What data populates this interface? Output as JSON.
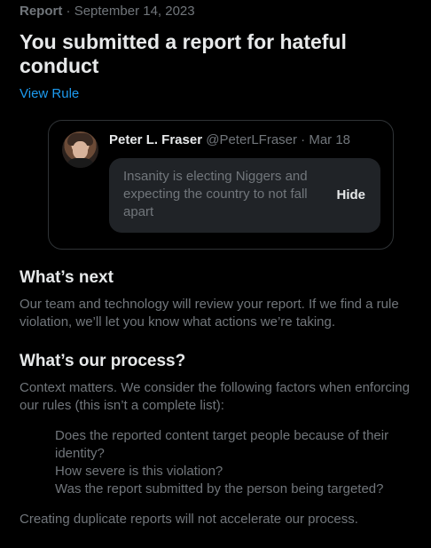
{
  "report": {
    "label": "Report",
    "separator": "·",
    "date": "September 14, 2023",
    "title": "You submitted a report for hateful conduct",
    "view_rule_label": "View Rule"
  },
  "tweet": {
    "author_name": "Peter L. Fraser",
    "author_handle": "@PeterLFraser",
    "separator": "·",
    "date": "Mar 18",
    "text": "Insanity is electing Niggers and expecting the country to not fall apart",
    "hide_label": "Hide"
  },
  "whats_next": {
    "heading": "What’s next",
    "body": "Our team and technology will review your report. If we find a rule violation, we’ll let you know what actions we’re taking."
  },
  "process": {
    "heading": "What’s our process?",
    "intro": "Context matters. We consider the following factors when enforcing our rules (this isn’t a complete list):",
    "factors": [
      "Does the reported content target people because of their identity?",
      "How severe is this violation?",
      "Was the report submitted by the person being targeted?"
    ],
    "footer": "Creating duplicate reports will not accelerate our process."
  },
  "colors": {
    "background": "#000000",
    "primary_text": "#e7e9ea",
    "secondary_text": "#71767b",
    "link": "#1d9bf0",
    "border": "#2f3336",
    "bubble": "#202327"
  }
}
